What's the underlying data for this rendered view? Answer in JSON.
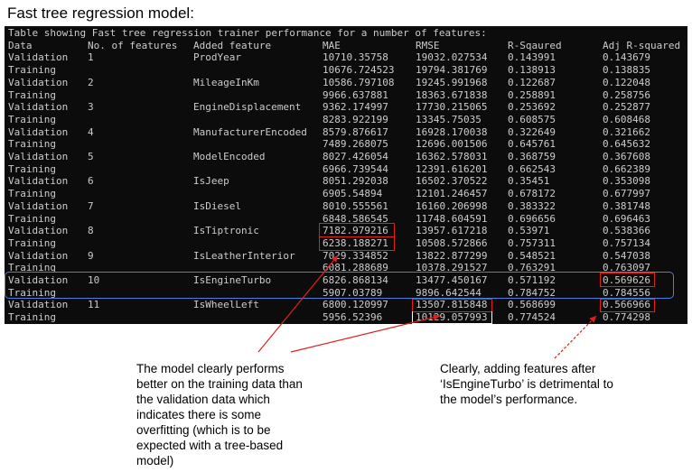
{
  "title": "Fast tree regression model:",
  "terminal": {
    "caption": "Table showing Fast tree regression trainer performance for a number of features:",
    "headers": {
      "data": "Data",
      "num": "No. of features",
      "feature": "Added feature",
      "mae": "MAE",
      "rmse": "RMSE",
      "r2": "R-Sqaured",
      "adj": "Adj R-squared"
    },
    "rows": [
      {
        "data": "Validation",
        "num": "1",
        "feature": "ProdYear",
        "mae": "10710.35758",
        "rmse": "19032.027534",
        "r2": "0.143991",
        "adj": "0.143679"
      },
      {
        "data": "Training",
        "num": "",
        "feature": "",
        "mae": "10676.724523",
        "rmse": "19794.381769",
        "r2": "0.138913",
        "adj": "0.138835"
      },
      {
        "data": "Validation",
        "num": "2",
        "feature": "MileageInKm",
        "mae": "10586.797108",
        "rmse": "19245.991968",
        "r2": "0.122687",
        "adj": "0.122048"
      },
      {
        "data": "Training",
        "num": "",
        "feature": "",
        "mae": "9966.637881",
        "rmse": "18363.671838",
        "r2": "0.258891",
        "adj": "0.258756"
      },
      {
        "data": "Validation",
        "num": "3",
        "feature": "EngineDisplacement",
        "mae": "9362.174997",
        "rmse": "17730.215065",
        "r2": "0.253692",
        "adj": "0.252877"
      },
      {
        "data": "Training",
        "num": "",
        "feature": "",
        "mae": "8283.922199",
        "rmse": "13345.75035",
        "r2": "0.608575",
        "adj": "0.608468"
      },
      {
        "data": "Validation",
        "num": "4",
        "feature": "ManufacturerEncoded",
        "mae": "8579.876617",
        "rmse": "16928.170038",
        "r2": "0.322649",
        "adj": "0.321662"
      },
      {
        "data": "Training",
        "num": "",
        "feature": "",
        "mae": "7489.268075",
        "rmse": "12696.001506",
        "r2": "0.645761",
        "adj": "0.645632"
      },
      {
        "data": "Validation",
        "num": "5",
        "feature": "ModelEncoded",
        "mae": "8027.426054",
        "rmse": "16362.578031",
        "r2": "0.368759",
        "adj": "0.367608"
      },
      {
        "data": "Training",
        "num": "",
        "feature": "",
        "mae": "6966.739544",
        "rmse": "12391.616201",
        "r2": "0.662543",
        "adj": "0.662389"
      },
      {
        "data": "Validation",
        "num": "6",
        "feature": "IsJeep",
        "mae": "8051.292038",
        "rmse": "16502.370522",
        "r2": "0.35451",
        "adj": "0.353098"
      },
      {
        "data": "Training",
        "num": "",
        "feature": "",
        "mae": "6905.54894",
        "rmse": "12101.246457",
        "r2": "0.678172",
        "adj": "0.677997"
      },
      {
        "data": "Validation",
        "num": "7",
        "feature": "IsDiesel",
        "mae": "8010.555561",
        "rmse": "16160.206998",
        "r2": "0.383322",
        "adj": "0.381748"
      },
      {
        "data": "Training",
        "num": "",
        "feature": "",
        "mae": "6848.586545",
        "rmse": "11748.604591",
        "r2": "0.696656",
        "adj": "0.696463"
      },
      {
        "data": "Validation",
        "num": "8",
        "feature": "IsTiptronic",
        "mae": "7182.979216",
        "rmse": "13957.617218",
        "r2": "0.53971",
        "adj": "0.538366"
      },
      {
        "data": "Training",
        "num": "",
        "feature": "",
        "mae": "6238.188271",
        "rmse": "10508.572866",
        "r2": "0.757311",
        "adj": "0.757134"
      },
      {
        "data": "Validation",
        "num": "9",
        "feature": "IsLeatherInterior",
        "mae": "7029.334852",
        "rmse": "13822.877299",
        "r2": "0.548521",
        "adj": "0.547038"
      },
      {
        "data": "Training",
        "num": "",
        "feature": "",
        "mae": "6081.288689",
        "rmse": "10378.291527",
        "r2": "0.763291",
        "adj": "0.763097"
      },
      {
        "data": "Validation",
        "num": "10",
        "feature": "IsEngineTurbo",
        "mae": "6826.868134",
        "rmse": "13477.450167",
        "r2": "0.571192",
        "adj": "0.569626"
      },
      {
        "data": "Training",
        "num": "",
        "feature": "",
        "mae": "5907.03789",
        "rmse": "9896.642544",
        "r2": "0.784752",
        "adj": "0.784556"
      },
      {
        "data": "Validation",
        "num": "11",
        "feature": "IsWheelLeft",
        "mae": "6800.120997",
        "rmse": "13507.815848",
        "r2": "0.568699",
        "adj": "0.566966"
      },
      {
        "data": "Training",
        "num": "",
        "feature": "",
        "mae": "5956.52396",
        "rmse": "10129.057993",
        "r2": "0.774524",
        "adj": "0.774298"
      }
    ]
  },
  "annotations": {
    "left": "The model clearly performs better on the training data than the validation data which indicates there is some overfitting (which is to be expected with a tree-based model)",
    "right": "Clearly, adding features after ‘IsEngineTurbo’ is detrimental to the model’s performance."
  },
  "colors": {
    "terminal_bg": "#0c0c0c",
    "terminal_text": "#cccccc",
    "highlight_red": "#e02020",
    "highlight_blue": "#4a80d8"
  }
}
